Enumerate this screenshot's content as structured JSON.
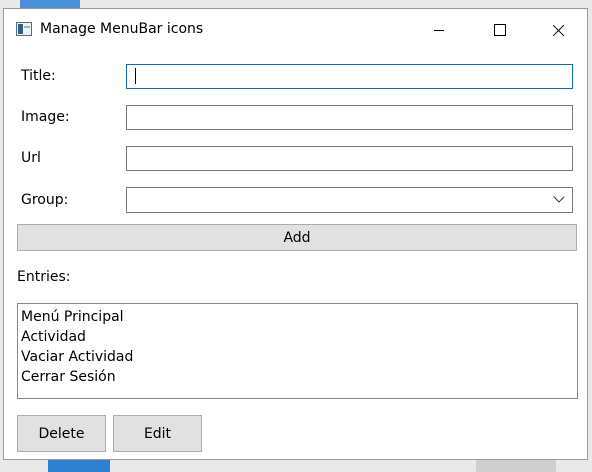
{
  "window": {
    "title": "Manage MenuBar icons",
    "controls": {
      "minimize": "minimize",
      "maximize": "maximize",
      "close": "close"
    }
  },
  "form": {
    "title_label": "Title:",
    "title_value": "",
    "image_label": "Image:",
    "image_value": "",
    "url_label": "Url",
    "url_value": "",
    "group_label": "Group:",
    "group_value": ""
  },
  "add_button": "Add",
  "entries": {
    "label": "Entries:",
    "items": [
      "Menú Principal",
      "Actividad",
      "Vaciar Actividad",
      "Cerrar Sesión"
    ]
  },
  "actions": {
    "delete": "Delete",
    "edit": "Edit"
  },
  "icons": {
    "app": "window-app-icon",
    "minimize": "minimize-icon",
    "maximize": "maximize-icon",
    "close": "close-icon",
    "dropdown": "chevron-down-icon"
  },
  "colors": {
    "focus_border": "#0f6db8",
    "button_bg": "#e1e1e1",
    "border": "#7a7a7a"
  }
}
